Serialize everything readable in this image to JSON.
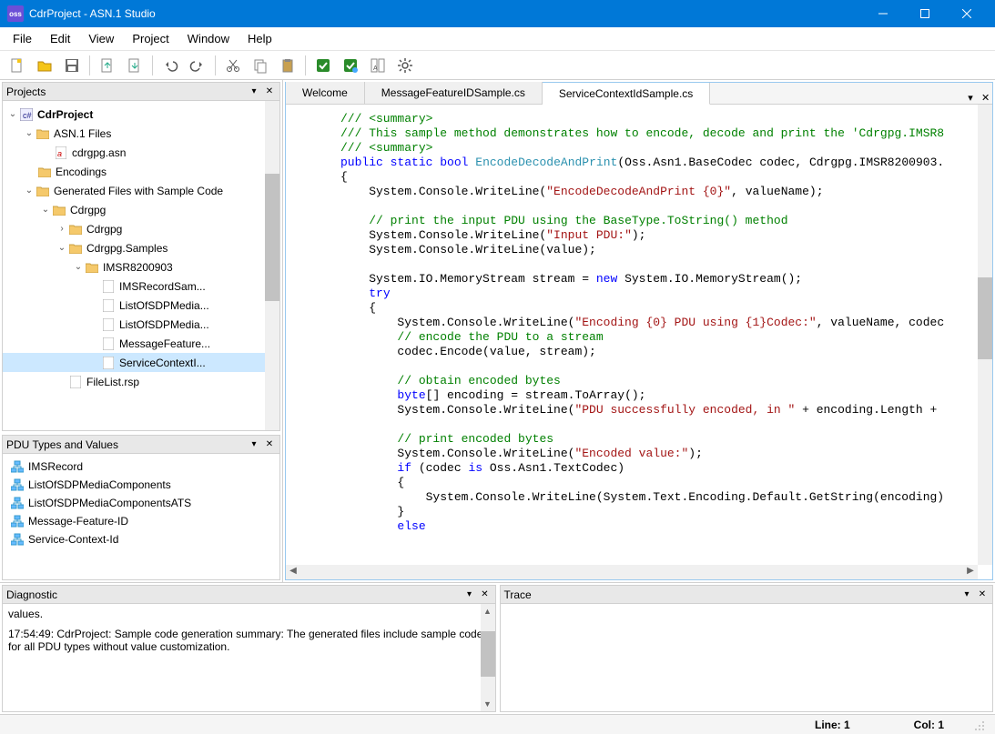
{
  "window": {
    "title": "CdrProject - ASN.1 Studio"
  },
  "menu": {
    "file": "File",
    "edit": "Edit",
    "view": "View",
    "project": "Project",
    "window": "Window",
    "help": "Help"
  },
  "panels": {
    "projects": "Projects",
    "pdu": "PDU Types and Values",
    "diagnostic": "Diagnostic",
    "trace": "Trace"
  },
  "tree": {
    "root": "CdrProject",
    "asn1files": "ASN.1 Files",
    "asnfile": "cdrgpg.asn",
    "encodings": "Encodings",
    "gen": "Generated Files with Sample Code",
    "cdrgpg1": "Cdrgpg",
    "cdrgpg2": "Cdrgpg",
    "samples": "Cdrgpg.Samples",
    "imsr": "IMSR8200903",
    "leaf1": "IMSRecordSam...",
    "leaf2": "ListOfSDPMedia...",
    "leaf3": "ListOfSDPMedia...",
    "leaf4": "MessageFeature...",
    "leaf5": "ServiceContextI...",
    "filelist": "FileList.rsp"
  },
  "pdu": {
    "i1": "IMSRecord",
    "i2": "ListOfSDPMediaComponents",
    "i3": "ListOfSDPMediaComponentsATS",
    "i4": "Message-Feature-ID",
    "i5": "Service-Context-Id"
  },
  "tabs": {
    "t1": "Welcome",
    "t2": "MessageFeatureIDSample.cs",
    "t3": "ServiceContextIdSample.cs"
  },
  "diagnostic": {
    "line0": "values.",
    "line1": "17:54:49: CdrProject: Sample code generation summary: The generated files include sample code for all PDU types without value customization."
  },
  "status": {
    "line": "Line: 1",
    "col": "Col: 1"
  },
  "code_lines": [
    {
      "t": "cm",
      "v": "/// <summary>"
    },
    {
      "t": "cm",
      "v": "/// This sample method demonstrates how to encode, decode and print the 'Cdrgpg.IMSR8"
    },
    {
      "t": "cm",
      "v": "/// <summary>"
    },
    {
      "t": "mix",
      "v": "public static bool <tp>EncodeDecodeAndPrint</tp>(Oss.Asn1.BaseCodec codec, Cdrgpg.IMSR8200903."
    },
    {
      "t": "",
      "v": "{"
    },
    {
      "t": "",
      "v": "    System.Console.WriteLine(<st>\"EncodeDecodeAndPrint {0}\"</st>, valueName);"
    },
    {
      "t": "",
      "v": ""
    },
    {
      "t": "cm2",
      "v": "    // print the input PDU using the BaseType.ToString() method"
    },
    {
      "t": "",
      "v": "    System.Console.WriteLine(<st>\"Input PDU:\"</st>);"
    },
    {
      "t": "",
      "v": "    System.Console.WriteLine(value);"
    },
    {
      "t": "",
      "v": ""
    },
    {
      "t": "",
      "v": "    System.IO.MemoryStream stream = <kw>new</kw> System.IO.MemoryStream();"
    },
    {
      "t": "",
      "v": "    <kw>try</kw>"
    },
    {
      "t": "",
      "v": "    {"
    },
    {
      "t": "",
      "v": "        System.Console.WriteLine(<st>\"Encoding {0} PDU using {1}Codec:\"</st>, valueName, codec"
    },
    {
      "t": "cm2",
      "v": "        // encode the PDU to a stream"
    },
    {
      "t": "",
      "v": "        codec.Encode(value, stream);"
    },
    {
      "t": "",
      "v": ""
    },
    {
      "t": "cm2",
      "v": "        // obtain encoded bytes"
    },
    {
      "t": "",
      "v": "        <kw>byte</kw>[] encoding = stream.ToArray();"
    },
    {
      "t": "",
      "v": "        System.Console.WriteLine(<st>\"PDU successfully encoded, in \"</st> + encoding.Length + "
    },
    {
      "t": "",
      "v": ""
    },
    {
      "t": "cm2",
      "v": "        // print encoded bytes"
    },
    {
      "t": "",
      "v": "        System.Console.WriteLine(<st>\"Encoded value:\"</st>);"
    },
    {
      "t": "",
      "v": "        <kw>if</kw> (codec <kw>is</kw> Oss.Asn1.TextCodec)"
    },
    {
      "t": "",
      "v": "        {"
    },
    {
      "t": "",
      "v": "            System.Console.WriteLine(System.Text.Encoding.Default.GetString(encoding)"
    },
    {
      "t": "",
      "v": "        }"
    },
    {
      "t": "",
      "v": "        <kw>else</kw>"
    }
  ]
}
